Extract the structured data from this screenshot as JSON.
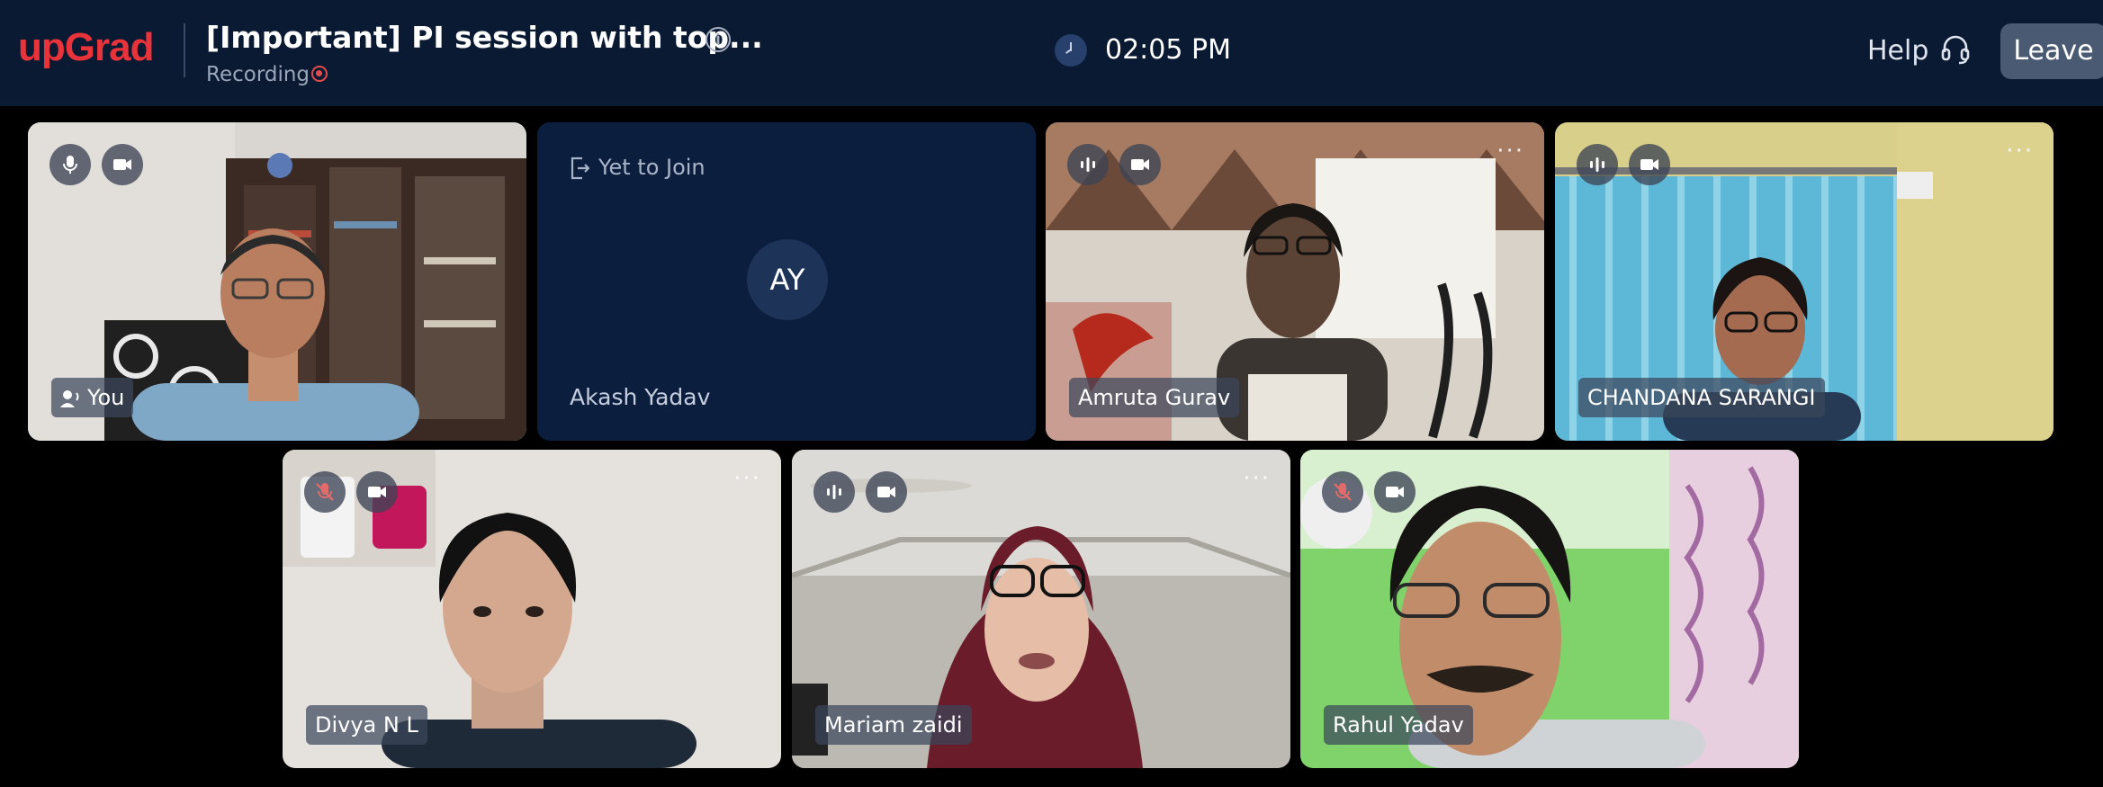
{
  "header": {
    "logo": "upGrad",
    "meeting_title": "[Important] PI session with top...",
    "info_icon": "info-icon",
    "recording_label": "Recording",
    "time": "02:05 PM",
    "help_label": "Help",
    "leave_label": "Leave"
  },
  "participants": [
    {
      "name": "You",
      "mic": "on",
      "camera": "on"
    },
    {
      "name": "Akash Yadav",
      "status": "Yet to Join",
      "initials": "AY"
    },
    {
      "name": "Amruta Gurav",
      "mic": "speaking",
      "camera": "on"
    },
    {
      "name": "CHANDANA SARANGI",
      "mic": "speaking",
      "camera": "on"
    },
    {
      "name": "Divya N L",
      "mic": "muted",
      "camera": "on"
    },
    {
      "name": "Mariam zaidi",
      "mic": "speaking",
      "camera": "on"
    },
    {
      "name": "Rahul Yadav",
      "mic": "muted",
      "camera": "on"
    }
  ],
  "colors": {
    "header_bg": "#0b1a33",
    "brand": "#e8333b",
    "recording": "#e24b4b",
    "leave_button": "#4b5a73",
    "join_tile_bg": "#0b1e3e"
  }
}
